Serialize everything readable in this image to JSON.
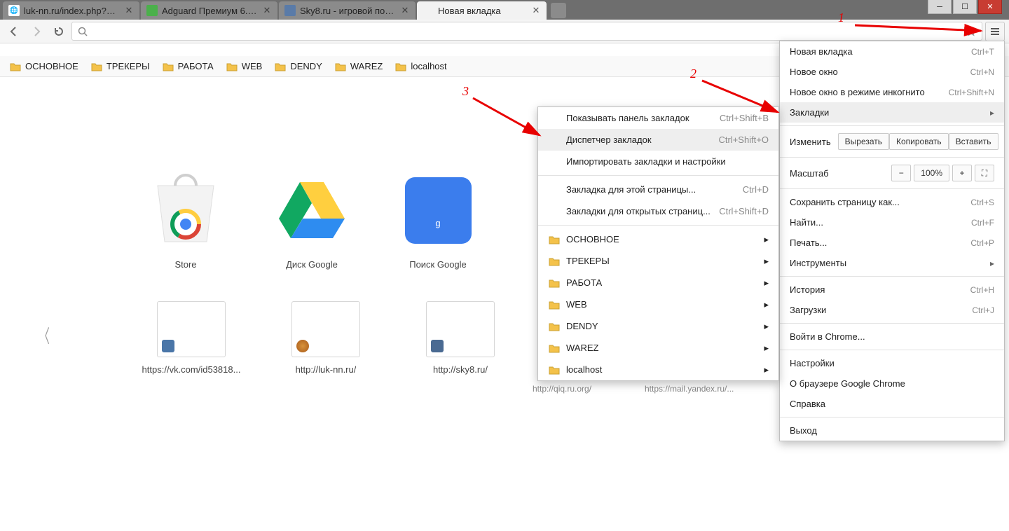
{
  "window_controls": {
    "min": "─",
    "max": "☐",
    "close": "✕"
  },
  "tabs": [
    {
      "title": "luk-nn.ru/index.php?view...",
      "favicon_bg": "#ffffff",
      "favicon_glyph": "🌐"
    },
    {
      "title": "Adguard Премиум 6.0.22...",
      "favicon_bg": "#4bb04b",
      "favicon_glyph": ""
    },
    {
      "title": "Sky8.ru - игровой портал",
      "favicon_bg": "#5a7ba8",
      "favicon_glyph": ""
    },
    {
      "title": "Новая вкладка",
      "favicon_bg": "transparent",
      "favicon_glyph": ""
    }
  ],
  "active_tab_index": 3,
  "bookmarks_bar": [
    "ОСНОВНОЕ",
    "ТРЕКЕРЫ",
    "РАБОТА",
    "WEB",
    "DENDY",
    "WAREZ",
    "localhost"
  ],
  "apps_row": [
    {
      "label": "Store"
    },
    {
      "label": "Диск Google"
    },
    {
      "label": "Поиск Google"
    }
  ],
  "mini_row": [
    {
      "label": "https://vk.com/id53818...",
      "icon_bg": "#4a76a8"
    },
    {
      "label": "http://luk-nn.ru/",
      "icon_bg": "#d8923a"
    },
    {
      "label": "http://sky8.ru/",
      "icon_bg": "#4a6a92"
    }
  ],
  "hidden_mini": [
    "http://qiq.ru.org/",
    "https://mail.yandex.ru/..."
  ],
  "main_menu": {
    "group1": [
      {
        "label": "Новая вкладка",
        "shortcut": "Ctrl+T"
      },
      {
        "label": "Новое окно",
        "shortcut": "Ctrl+N"
      },
      {
        "label": "Новое окно в режиме инкогнито",
        "shortcut": "Ctrl+Shift+N"
      },
      {
        "label": "Закладки",
        "shortcut": "",
        "submenu": true,
        "highlight": true
      }
    ],
    "edit": {
      "caption": "Изменить",
      "cut": "Вырезать",
      "copy": "Копировать",
      "paste": "Вставить"
    },
    "zoom": {
      "caption": "Масштаб",
      "value": "100%"
    },
    "group2": [
      {
        "label": "Сохранить страницу как...",
        "shortcut": "Ctrl+S"
      },
      {
        "label": "Найти...",
        "shortcut": "Ctrl+F"
      },
      {
        "label": "Печать...",
        "shortcut": "Ctrl+P"
      },
      {
        "label": "Инструменты",
        "shortcut": "",
        "submenu": true
      }
    ],
    "group3": [
      {
        "label": "История",
        "shortcut": "Ctrl+H"
      },
      {
        "label": "Загрузки",
        "shortcut": "Ctrl+J"
      }
    ],
    "group4": [
      {
        "label": "Войти в Chrome..."
      }
    ],
    "group5": [
      {
        "label": "Настройки"
      },
      {
        "label": "О браузере Google Chrome"
      },
      {
        "label": "Справка"
      }
    ],
    "group6": [
      {
        "label": "Выход"
      }
    ]
  },
  "bookmarks_submenu": {
    "top": [
      {
        "label": "Показывать панель закладок",
        "shortcut": "Ctrl+Shift+B"
      },
      {
        "label": "Диспетчер закладок",
        "shortcut": "Ctrl+Shift+O",
        "highlight": true
      },
      {
        "label": "Импортировать закладки и настройки",
        "shortcut": ""
      }
    ],
    "mid": [
      {
        "label": "Закладка для этой страницы...",
        "shortcut": "Ctrl+D"
      },
      {
        "label": "Закладки для открытых страниц...",
        "shortcut": "Ctrl+Shift+D"
      }
    ],
    "folders": [
      "ОСНОВНОЕ",
      "ТРЕКЕРЫ",
      "РАБОТА",
      "WEB",
      "DENDY",
      "WAREZ",
      "localhost"
    ]
  },
  "annotations": {
    "n1": "1",
    "n2": "2",
    "n3": "3"
  }
}
